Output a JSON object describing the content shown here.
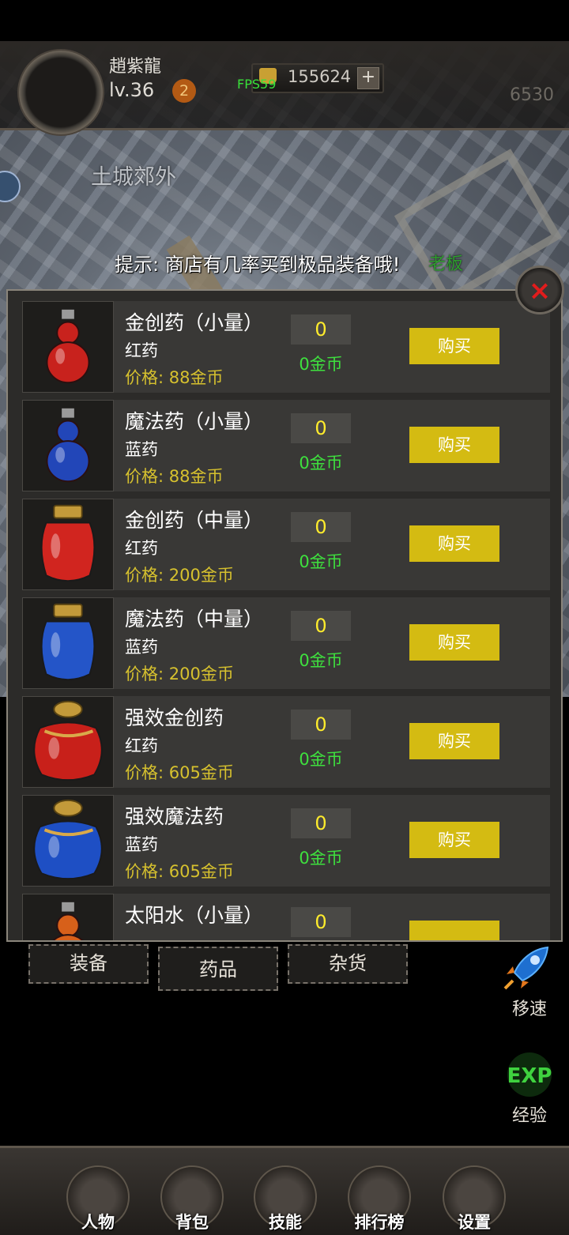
{
  "hud": {
    "player_name": "趙紫龍",
    "level": "lv.36",
    "level_badge": "2",
    "gold": "155624",
    "gold_add": "+",
    "fps": "FPS59",
    "right_value": "6530"
  },
  "map": {
    "zone_name": "土城郊外",
    "tip": "提示: 商店有几率买到极品装备哦!",
    "tip_overlap": "老板"
  },
  "shop": {
    "close_label": "×",
    "items": [
      {
        "name": "金创药（小量）",
        "type": "红药",
        "price": "价格: 88金币",
        "qty": "0",
        "cost": "0金币",
        "buy": "购买",
        "color": "#c8221d",
        "shape": "gourd"
      },
      {
        "name": "魔法药（小量）",
        "type": "蓝药",
        "price": "价格: 88金币",
        "qty": "0",
        "cost": "0金币",
        "buy": "购买",
        "color": "#2246b8",
        "shape": "gourd"
      },
      {
        "name": "金创药（中量）",
        "type": "红药",
        "price": "价格: 200金币",
        "qty": "0",
        "cost": "0金币",
        "buy": "购买",
        "color": "#d1251f",
        "shape": "jar"
      },
      {
        "name": "魔法药（中量）",
        "type": "蓝药",
        "price": "价格: 200金币",
        "qty": "0",
        "cost": "0金币",
        "buy": "购买",
        "color": "#2455c8",
        "shape": "jar"
      },
      {
        "name": "强效金创药",
        "type": "红药",
        "price": "价格: 605金币",
        "qty": "0",
        "cost": "0金币",
        "buy": "购买",
        "color": "#c8201a",
        "shape": "big-jar"
      },
      {
        "name": "强效魔法药",
        "type": "蓝药",
        "price": "价格: 605金币",
        "qty": "0",
        "cost": "0金币",
        "buy": "购买",
        "color": "#1e4fc4",
        "shape": "big-jar"
      },
      {
        "name": "太阳水（小量）",
        "type": "",
        "price": "",
        "qty": "0",
        "cost": "",
        "buy": "",
        "color": "#d7601a",
        "shape": "gourd"
      }
    ]
  },
  "tabs": [
    {
      "label": "装备",
      "active": false
    },
    {
      "label": "药品",
      "active": true
    },
    {
      "label": "杂货",
      "active": false
    }
  ],
  "side_buttons": [
    {
      "label": "移速",
      "icon": "rocket-icon"
    },
    {
      "label": "经验",
      "icon": "exp-icon",
      "icon_text": "EXP"
    }
  ],
  "bottom_nav": [
    {
      "label": "人物",
      "icon": "character-icon"
    },
    {
      "label": "背包",
      "icon": "backpack-icon"
    },
    {
      "label": "技能",
      "icon": "skills-icon"
    },
    {
      "label": "排行榜",
      "icon": "ranking-icon"
    },
    {
      "label": "设置",
      "icon": "settings-icon"
    }
  ]
}
